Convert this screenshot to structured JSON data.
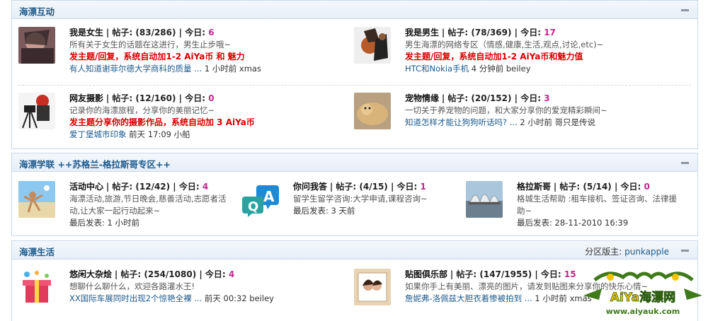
{
  "sections": [
    {
      "title": "海漂互动",
      "forums": [
        {
          "name": "我是女生",
          "stats_label": "| 帖子: (83/286) | 今日: ",
          "today": "6",
          "desc": "所有关于女生的话题在这进行，男生止步哦~",
          "highlight": "发主题/回复，系统自动加1-2 AiYa币 和 魅力",
          "last_post_title": "有人知道谢菲尔德大学商科的质量 ...",
          "last_post_meta": " 1 小时前 xmas"
        },
        {
          "name": "我是男生",
          "stats_label": "| 帖子: (78/369) | 今日: ",
          "today": "17",
          "desc": "男生海漂的网络专区（情感,健康,生活,观点,讨论,etc)~",
          "highlight": "发主题/回复，系统自动加1-2 AiYa币和魅力值",
          "last_post_title": "HTC和Nokia手机",
          "last_post_meta": " 4 分钟前 beiley"
        },
        {
          "name": "网友摄影",
          "stats_label": "| 帖子: (12/160) | 今日: ",
          "today": "0",
          "desc": "记录你的海漂旅程，分享你的美丽记忆~",
          "highlight": "发主题分享你的摄影作品，系统自动加 3 AiYa币",
          "last_post_title": "爱丁堡城市印象",
          "last_post_meta": " 前天 17:09 小船"
        },
        {
          "name": "宠物情缘",
          "stats_label": "| 帖子: (20/152) | 今日: ",
          "today": "3",
          "desc": "一切关于养宠物的问题，和大家分享你的爱宠精彩瞬间~",
          "highlight": "",
          "last_post_title": "知道怎样才能让狗狗听话吗? ...",
          "last_post_meta": " 2 小时前 哥只是传说"
        }
      ]
    },
    {
      "title": "海漂学联 ++苏格兰-格拉斯哥专区++",
      "forums": [
        {
          "name": "活动中心",
          "stats_label": "| 帖子: (12/42) | 今日: ",
          "today": "4",
          "desc_lines": [
            "海漂活动,旅游,节日晚会,慈善活动,志愿者活",
            "动,让大家一起行动起来~"
          ],
          "last_label": "最后发表: ",
          "last_value": "1 小时前"
        },
        {
          "name": "你问我答",
          "stats_label": "| 帖子: (4/15) | 今日: ",
          "today": "1",
          "desc_lines": [
            "留学生留学咨询:大学申请,课程咨询~"
          ],
          "last_label": "最后发表: ",
          "last_value": "3 天前"
        },
        {
          "name": "格拉斯哥",
          "stats_label": "| 帖子: (5/14) | 今日: ",
          "today": "0",
          "desc_lines": [
            "格城生活帮助 :租车接机、签证咨询、法律援",
            "助~"
          ],
          "last_label": "最后发表: ",
          "last_value": "28-11-2010 16:39"
        }
      ]
    },
    {
      "title": "海漂生活",
      "moderator_label": "分区版主: ",
      "moderator": "punkapple",
      "forums": [
        {
          "name": "悠闲大杂烩",
          "stats_label": "| 帖子: (254/1080) | 今日: ",
          "today": "4",
          "desc": "想聊什么聊什么，欢迎各路灌水王!",
          "last_post_title": "XX国际车展同时出现2个惊艳全裸 ...",
          "last_post_meta": " 前天 00:32 beiley"
        },
        {
          "name": "贴图俱乐部",
          "stats_label": "| 帖子: (147/1955) | 今日: ",
          "today": "15",
          "desc": "如果你手上有美丽、漂亮的图片，请发到贴图来分享你的快乐心情~",
          "last_post_title": "詹妮弗-洛佩兹大胆衣着惨被拍到 ...",
          "last_post_meta": " 1 小时前 xmas"
        }
      ]
    }
  ],
  "logo": {
    "text": "AiYa海漂网",
    "url": "www.aiyauk.com"
  },
  "colors": {
    "accent": "#1c5a8e",
    "today": "#c0288c",
    "highlight": "#d90000"
  }
}
